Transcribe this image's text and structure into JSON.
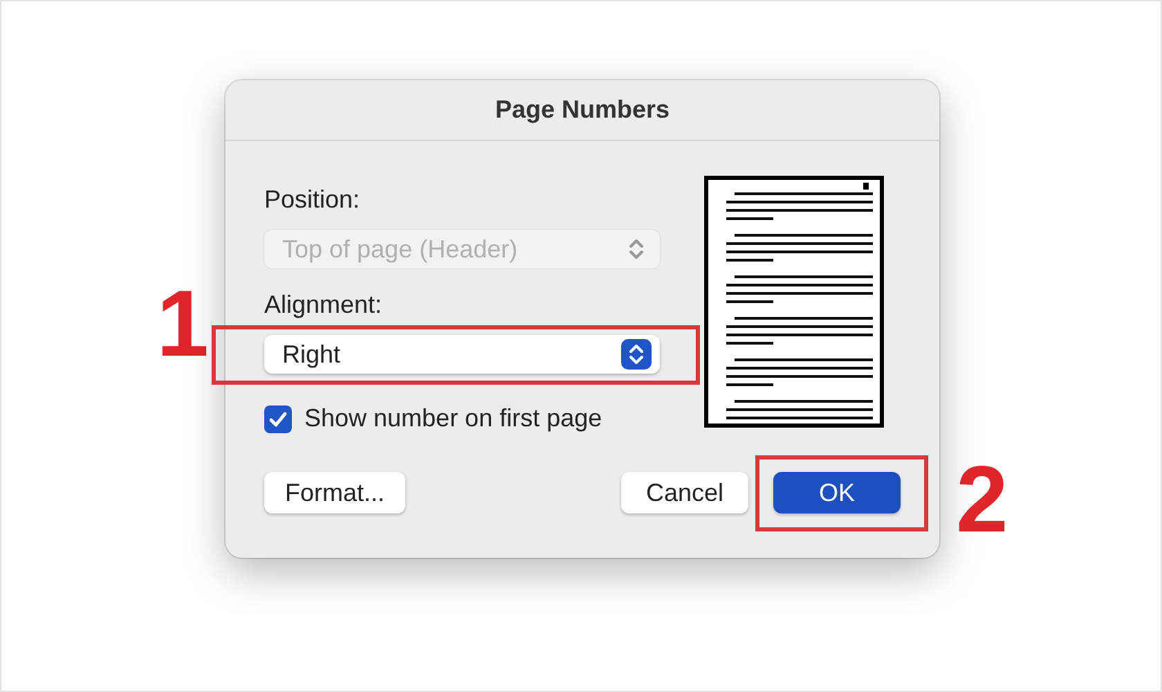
{
  "dialog": {
    "title": "Page Numbers",
    "position": {
      "label": "Position:",
      "value": "Top of page (Header)",
      "disabled": true,
      "highlighted": false
    },
    "alignment": {
      "label": "Alignment:",
      "value": "Right",
      "disabled": false,
      "highlighted": true
    },
    "first_page": {
      "label": "Show number on first page",
      "checked": true
    },
    "buttons": [
      {
        "label": "Format...",
        "kind": "normal",
        "highlighted": false
      },
      {
        "label": "Cancel",
        "kind": "normal",
        "highlighted": false
      },
      {
        "label": "OK",
        "kind": "default",
        "highlighted": true
      }
    ]
  },
  "annotations": [
    {
      "label": "1"
    },
    {
      "label": "2"
    }
  ]
}
